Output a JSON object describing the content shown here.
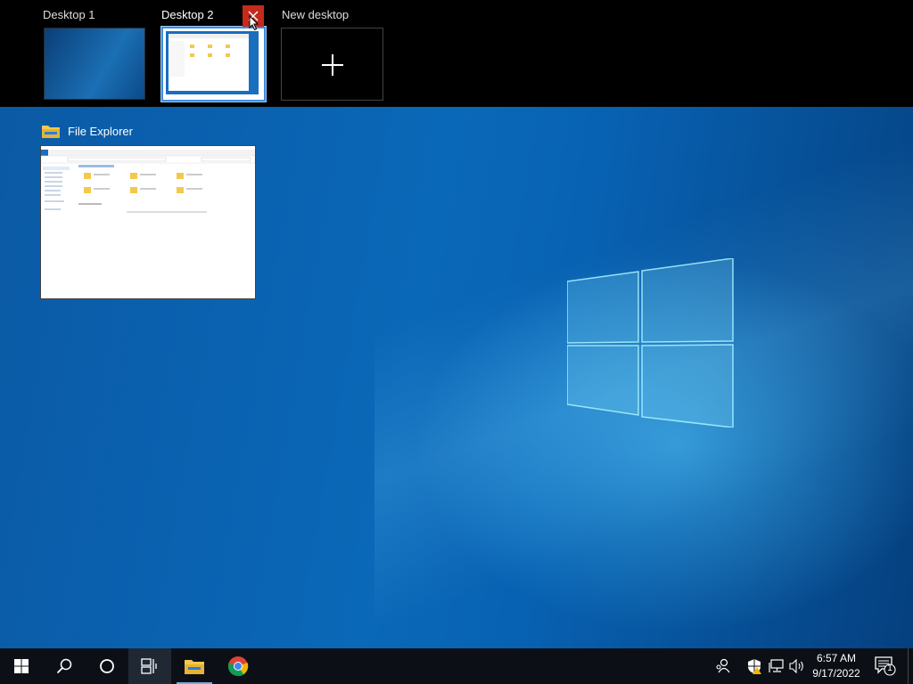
{
  "desktops": [
    {
      "label": "Desktop 1",
      "active": false
    },
    {
      "label": "Desktop 2",
      "active": true
    },
    {
      "label": "New desktop"
    }
  ],
  "window_card": {
    "title": "File Explorer",
    "icon": "folder-icon"
  },
  "explorer_preview": {
    "address": "Quick access",
    "section_frequent": "Frequent folders (6)",
    "section_recent": "Recent files (0)",
    "folders": [
      "Desktop",
      "Downloads",
      "Documents",
      "Pictures",
      "Music",
      "Videos"
    ],
    "nav": [
      "Quick access",
      "Desktop",
      "Downloads",
      "Documents",
      "Pictures",
      "Music",
      "Videos",
      "This PC",
      "Network"
    ]
  },
  "taskbar": {
    "start": "windows-start-icon",
    "search": "search-icon",
    "cortana": "cortana-icon",
    "task_view": "task-view-icon",
    "apps": [
      "file-explorer-icon",
      "chrome-icon"
    ],
    "time": "6:57 AM",
    "date": "9/17/2022",
    "notification_count": "1"
  },
  "colors": {
    "accent": "#3a8ee6",
    "close_red": "#c42b1c",
    "taskbar": "#0c1016"
  }
}
